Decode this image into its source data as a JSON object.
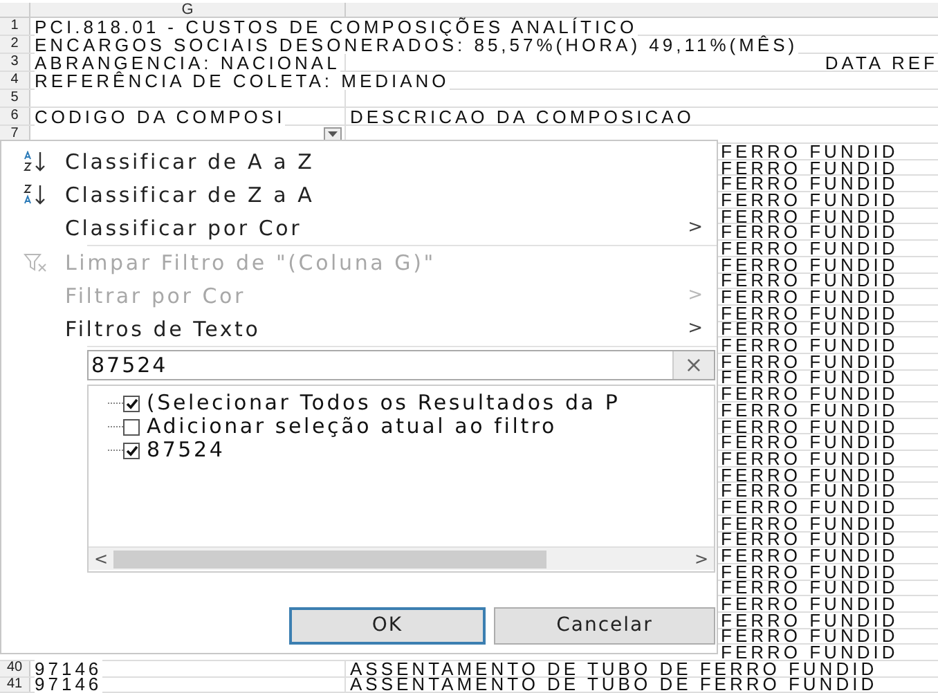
{
  "sheet": {
    "column_header": "G",
    "top_rows": [
      {
        "number": "1",
        "g": "PCI.818.01 - CUSTOS DE COMPOSIÇÕES ANALÍTICO"
      },
      {
        "number": "2",
        "g": "ENCARGOS SOCIAIS DESONERADOS: 85,57%(HORA)   49,11%(MÊS)"
      },
      {
        "number": "3",
        "g": "ABRANGENCIA: NACIONAL",
        "h": "DATA REF"
      },
      {
        "number": "4",
        "g": "REFERÊNCIA DE COLETA: MEDIANO"
      },
      {
        "number": "5"
      },
      {
        "number": "6",
        "g": "CODIGO DA COMPOSI",
        "h": "DESCRICAO DA COMPOSICAO"
      },
      {
        "number": "7",
        "filter_button": true
      }
    ],
    "covered_rows": [
      "FERRO FUNDID",
      "FERRO FUNDID",
      "FERRO FUNDID",
      "FERRO FUNDID",
      "FERRO FUNDID",
      "FERRO FUNDID",
      "FERRO FUNDID",
      "FERRO FUNDID",
      "FERRO FUNDID",
      "FERRO FUNDID",
      "FERRO FUNDID",
      "FERRO FUNDID",
      "FERRO FUNDID",
      "FERRO FUNDID",
      "FERRO FUNDID",
      "FERRO FUNDID",
      "FERRO FUNDID",
      "FERRO FUNDID",
      "FERRO FUNDID",
      "FERRO FUNDID",
      "FERRO FUNDID",
      "FERRO FUNDID",
      "FERRO FUNDID",
      "FERRO FUNDID",
      "FERRO FUNDID",
      "FERRO FUNDID",
      "FERRO FUNDID",
      "FERRO FUNDID",
      "FERRO FUNDID",
      "FERRO FUNDID",
      "FERRO FUNDID",
      "FERRO FUNDID"
    ],
    "bottom_rows": [
      {
        "number": "40",
        "g": "97146",
        "h": "ASSENTAMENTO DE TUBO DE FERRO FUNDID"
      },
      {
        "number": "41",
        "g": "97146",
        "h": "ASSENTAMENTO DE TUBO DE FERRO FUNDID"
      }
    ]
  },
  "filter_menu": {
    "items": [
      {
        "kind": "sort_az",
        "label": "Classificar de A a Z",
        "disabled": false
      },
      {
        "kind": "sort_za",
        "label": "Classificar de Z a A",
        "disabled": false
      },
      {
        "kind": "plain",
        "label": "Classificar por Cor",
        "submenu_arrow": ">",
        "disabled": false
      },
      {
        "kind": "clear_filter",
        "label": "Limpar Filtro de \"(Coluna G)\"",
        "disabled": true
      },
      {
        "kind": "plain",
        "label": "Filtrar por Cor",
        "submenu_arrow": ">",
        "disabled": true
      },
      {
        "kind": "plain",
        "label": "Filtros de Texto",
        "submenu_arrow": ">",
        "disabled": false
      }
    ],
    "search": {
      "value": "87524",
      "clear": "×"
    },
    "values": [
      {
        "label": "(Selecionar Todos os Resultados da P",
        "checked": true
      },
      {
        "label": "Adicionar seleção atual ao filtro",
        "checked": false
      },
      {
        "label": "87524",
        "checked": true
      }
    ],
    "scroll_left": "<",
    "scroll_right": ">",
    "buttons": [
      "OK",
      "Cancelar"
    ]
  }
}
